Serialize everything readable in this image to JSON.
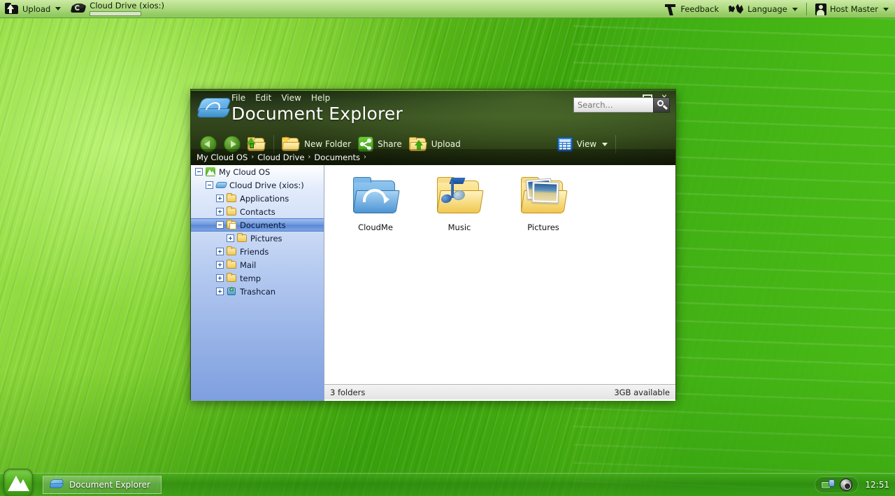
{
  "topbar": {
    "upload": {
      "label": "Upload",
      "icon": "upload-icon",
      "caret": "caret-down-icon"
    },
    "cloud_drive": {
      "label": "Cloud Drive (xios:)",
      "icon": "drive-icon",
      "progress_percent": 4
    },
    "center_logo": "mountain-logo-icon",
    "feedback": {
      "label": "Feedback",
      "icon": "feedback-icon"
    },
    "language": {
      "label": "Language",
      "icon": "world-map-icon",
      "caret": "caret-down-icon"
    },
    "host_master": {
      "label": "Host Master",
      "icon": "user-icon",
      "caret": "caret-down-icon"
    }
  },
  "window": {
    "title": "Document Explorer",
    "drive_icon": "cloud-drive-icon",
    "menus": [
      "File",
      "Edit",
      "View",
      "Help"
    ],
    "controls": {
      "minimize": "_",
      "maximize": "□",
      "close": "x"
    },
    "toolbar": {
      "back": "back-arrow-icon",
      "forward": "forward-arrow-icon",
      "up": "up-folder-icon",
      "new_folder": "New Folder",
      "share": "Share",
      "upload": "Upload",
      "view": "View",
      "view_caret": "caret-down-icon"
    },
    "search": {
      "placeholder": "Search...",
      "value": "",
      "button_icon": "search-icon"
    },
    "breadcrumb": [
      "My Cloud OS",
      "Cloud Drive",
      "Documents"
    ],
    "breadcrumb_separator": "›",
    "tree": [
      {
        "label": "My Cloud OS",
        "depth": 0,
        "expander": "minus",
        "icon": "mountain-icon",
        "selected": false
      },
      {
        "label": "Cloud Drive (xios:)",
        "depth": 1,
        "expander": "minus",
        "icon": "drive-icon",
        "selected": false
      },
      {
        "label": "Applications",
        "depth": 2,
        "expander": "plus",
        "icon": "folder-icon",
        "selected": false
      },
      {
        "label": "Contacts",
        "depth": 2,
        "expander": "plus",
        "icon": "folder-icon",
        "selected": false
      },
      {
        "label": "Documents",
        "depth": 2,
        "expander": "minus",
        "icon": "documents-folder-icon",
        "selected": true
      },
      {
        "label": "Pictures",
        "depth": 3,
        "expander": "plus",
        "icon": "folder-icon",
        "selected": false
      },
      {
        "label": "Friends",
        "depth": 2,
        "expander": "plus",
        "icon": "folder-icon",
        "selected": false
      },
      {
        "label": "Mail",
        "depth": 2,
        "expander": "plus",
        "icon": "folder-icon",
        "selected": false
      },
      {
        "label": "temp",
        "depth": 2,
        "expander": "plus",
        "icon": "folder-icon",
        "selected": false
      },
      {
        "label": "Trashcan",
        "depth": 2,
        "expander": "plus",
        "icon": "trashcan-icon",
        "selected": false
      }
    ],
    "items": [
      {
        "label": "CloudMe",
        "kind": "cloud-folder"
      },
      {
        "label": "Music",
        "kind": "music-folder"
      },
      {
        "label": "Pictures",
        "kind": "pictures-folder"
      }
    ],
    "status": {
      "left": "3 folders",
      "right": "3GB available"
    }
  },
  "taskbar": {
    "start": "start-button-mountain-icon",
    "tasks": [
      {
        "label": "Document Explorer",
        "icon": "cloud-drive-icon"
      }
    ],
    "tray": {
      "network": "network-icon",
      "settings": "gear-icon",
      "clock": "12:51"
    }
  },
  "colors": {
    "desktop_green": "#4fae1d",
    "topbar_green": "#a9d87c",
    "window_header_dark": "#27381a",
    "tree_selection_blue": "#6f98dd",
    "accent_blue": "#1f66b4"
  }
}
